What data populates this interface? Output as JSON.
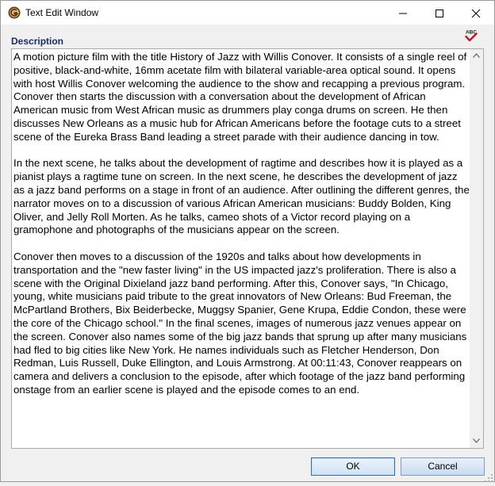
{
  "window": {
    "title": "Text Edit Window"
  },
  "icons": {
    "app": "app-logo-icon",
    "minimize": "minimize-icon",
    "maximize": "maximize-icon",
    "close": "close-icon",
    "spellcheck": "spellcheck-icon"
  },
  "spellcheck": {
    "label": "ABC"
  },
  "field": {
    "label": "Description",
    "paragraphs": [
      "A motion picture film with the title History of Jazz with Willis Conover. It consists of a single reel of positive, black-and-white, 16mm acetate film with bilateral variable-area optical sound. It opens with host Willis Conover welcoming the audience to the show and recapping a previous program. Conover then starts the discussion with a conversation about the development of African American music from West African music as drummers play conga drums on screen. He then discusses New Orleans as a music hub for African Americans before the footage cuts to a street scene of the Eureka Brass Band leading a street parade with their audience dancing in tow.",
      "In the next scene, he talks about the development of ragtime and describes how it is played as a pianist plays a ragtime tune on screen. In the next scene, he describes the development of jazz as a jazz band performs on a stage in front of an audience. After outlining the different genres, the narrator moves on to a discussion of various African American musicians: Buddy Bolden, King Oliver, and Jelly Roll Morten. As he talks, cameo shots of a Victor record playing on a gramophone and photographs of the musicians appear on the screen.",
      "Conover then moves to a discussion of the 1920s and talks about how developments in transportation and the \"new faster living\" in the US impacted jazz's proliferation. There is also a scene with the Original Dixieland jazz band performing. After this, Conover says, \"In Chicago, young, white musicians paid tribute to the great innovators of New Orleans: Bud Freeman, the McPartland Brothers, Bix Beiderbecke, Muggsy Spanier, Gene Krupa, Eddie Condon, these were the core of the Chicago school.\" In the final scenes, images of numerous jazz venues appear on the screen. Conover also names some of the big jazz bands that sprung up after many musicians had fled to big cities like New York. He names individuals such as Fletcher Henderson, Don Redman, Luis Russell, Duke Ellington, and Louis Armstrong. At 00:11:43, Conover reappears on camera and delivers a conclusion to the episode, after which footage of the jazz band performing onstage from an earlier scene is played and the episode comes to an end."
    ]
  },
  "buttons": {
    "ok": "OK",
    "cancel": "Cancel"
  },
  "colors": {
    "label": "#1a2a6c",
    "focus_border": "#2a6cc0",
    "spell_red": "#c8102e"
  }
}
